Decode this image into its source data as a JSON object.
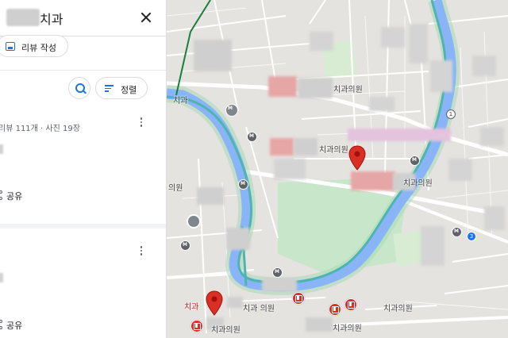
{
  "search": {
    "query": "치과"
  },
  "panel": {
    "review_button": "리뷰 작성",
    "sort_button": "정렬",
    "review_meta": "리뷰 111개 · 사진 19장",
    "share_label": "공유"
  },
  "map": {
    "labels": {
      "dental_clinic_1": "치과의원",
      "dental_clinic_2": "치과의원",
      "dental_clinic_3": "치과의원",
      "dental_clinic_4": "치과 의원",
      "dental_clinic_5": "치과의원",
      "dental_clinic_6": "치과의원",
      "dental_clinic_7": "치과의원",
      "dental_red": "치과",
      "edge_label_left_1": "치과",
      "edge_label_left_2": "의원"
    },
    "road_shields": {
      "shield_1": "1",
      "shield_3": "3"
    },
    "colors": {
      "pin": "#d93025",
      "river": "#8ab4f8",
      "road_teal": "#4fb4b0",
      "park": "#c8e6c9",
      "transit_line": "#188038"
    }
  }
}
